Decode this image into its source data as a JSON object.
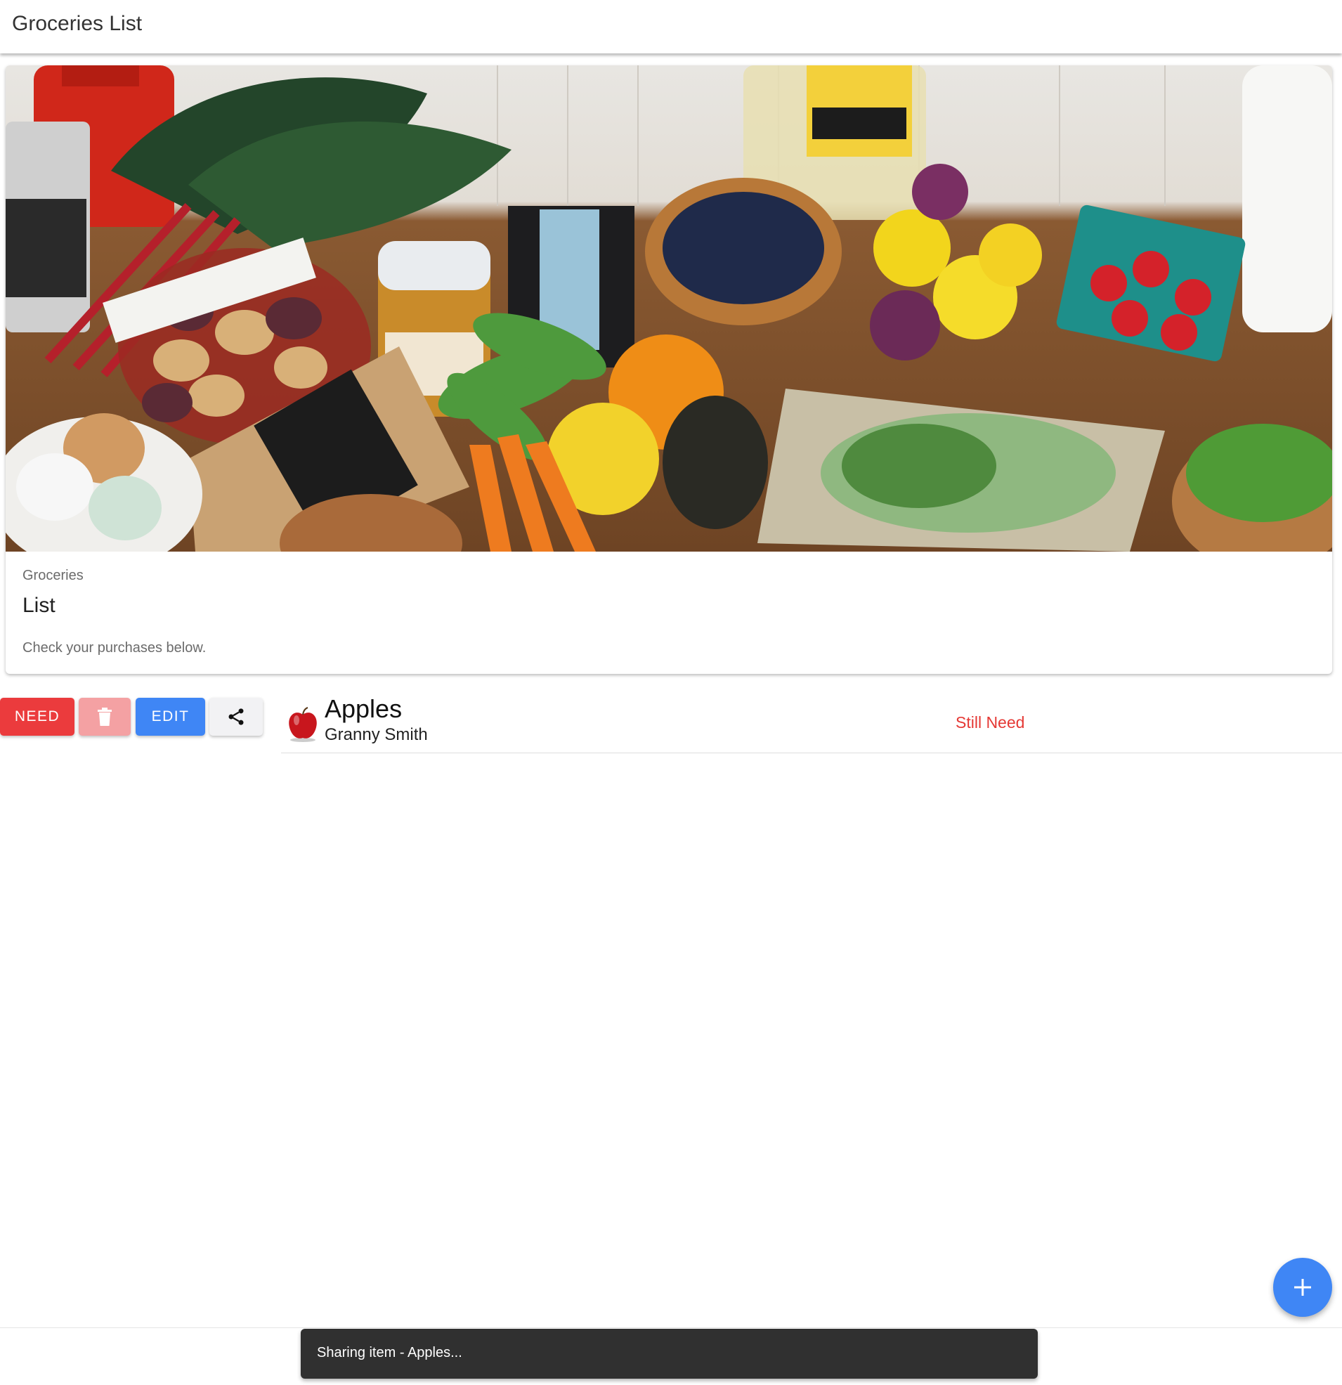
{
  "toolbar": {
    "title": "Groceries List"
  },
  "card": {
    "image": "groceries-hero-image",
    "subtitle": "Groceries",
    "title": "List",
    "text": "Check your purchases below."
  },
  "item": {
    "actions": {
      "need_label": "NEED",
      "delete_icon": "trash-icon",
      "edit_label": "EDIT",
      "share_icon": "share-icon"
    },
    "thumbnail_icon": "apple-photo-coming-soon",
    "name": "Apples",
    "variety": "Granny Smith",
    "status": "Still Need"
  },
  "fab": {
    "icon": "plus-icon"
  },
  "snackbar": {
    "message": "Sharing item - Apples..."
  },
  "colors": {
    "need": "#eb3b3d",
    "delete": "#f4a1a3",
    "edit": "#3f86f5",
    "fab": "#3f86f5",
    "status": "#e53935",
    "snackbar": "#303030"
  }
}
